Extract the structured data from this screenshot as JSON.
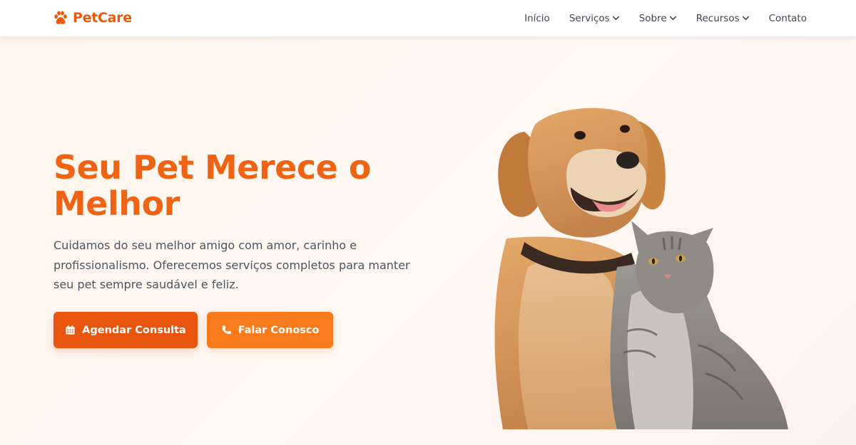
{
  "brand": {
    "name": "PetCare",
    "icon": "paw-icon",
    "color": "#ea5a0c"
  },
  "nav": {
    "items": [
      {
        "label": "Início",
        "has_dropdown": false
      },
      {
        "label": "Serviços",
        "has_dropdown": true
      },
      {
        "label": "Sobre",
        "has_dropdown": true
      },
      {
        "label": "Recursos",
        "has_dropdown": true
      },
      {
        "label": "Contato",
        "has_dropdown": false
      }
    ]
  },
  "hero": {
    "title": "Seu Pet Merece o Melhor",
    "description": "Cuidamos do seu melhor amigo com amor, carinho e profissionalismo. Oferecemos serviços completos para manter seu pet sempre saudável e feliz.",
    "primary_button": {
      "label": "Agendar Consulta",
      "icon": "calendar-icon",
      "color": "#e8550f"
    },
    "secondary_button": {
      "label": "Falar Conosco",
      "icon": "phone-icon",
      "color": "#f97b1c"
    },
    "image": {
      "subject": "golden retriever dog and tabby cat"
    }
  },
  "colors": {
    "accent": "#ee6414",
    "text": "#4b5563",
    "nav_text": "#3f4650"
  }
}
